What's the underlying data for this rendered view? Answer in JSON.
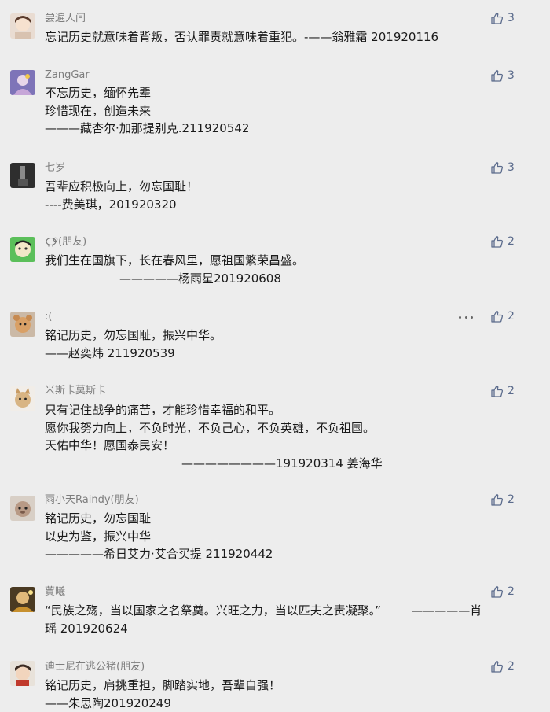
{
  "comments": [
    {
      "name": "尝遍人间",
      "lines": [
        "忘记历史就意味着背叛，否认罪责就意味着重犯。-——翁雅霜 201920116"
      ],
      "likes": "3"
    },
    {
      "name": "ZangGar",
      "lines": [
        "不忘历史，缅怀先辈",
        "珍惜现在，创造未来",
        "———藏杏尔·加那提别克.211920542"
      ],
      "likes": "3"
    },
    {
      "name": "七岁",
      "lines": [
        "吾辈应积极向上，勿忘国耻！",
        "----费美琪，201920320"
      ],
      "likes": "3"
    },
    {
      "name_suffix": "(朋友)",
      "lines": [
        "我们生在国旗下，长在春风里，愿祖国繁荣昌盛。",
        "—————杨雨星201920608"
      ],
      "likes": "2"
    },
    {
      "name": ":(",
      "lines": [
        "铭记历史，勿忘国耻，振兴中华。",
        "——赵奕炜 211920539"
      ],
      "likes": "2"
    },
    {
      "name": "米斯卡莫斯卡",
      "lines": [
        "只有记住战争的痛苦，才能珍惜幸福的和平。",
        "愿你我努力向上，不负时光，不负己心，不负英雄，不负祖国。",
        "天佑中华！愿国泰民安！",
        "————————191920314 姜海华"
      ],
      "likes": "2"
    },
    {
      "name": "雨小天Raindy(朋友)",
      "lines": [
        "铭记历史，勿忘国耻",
        "以史为鉴，振兴中华",
        "—————希日艾力·艾合买提 211920442"
      ],
      "likes": "2"
    },
    {
      "name": "蕒曦",
      "lines": [
        "“民族之殇，当以国家之名祭奠。兴旺之力，当以匹夫之责凝聚。”        —————肖",
        "瑶 201920624"
      ],
      "likes": "2"
    },
    {
      "name": "迪士尼在逃公猪(朋友)",
      "lines": [
        "铭记历史，肩挑重担，脚踏实地，吾辈自强！",
        "——朱思陶201920249"
      ],
      "likes": "2"
    }
  ]
}
